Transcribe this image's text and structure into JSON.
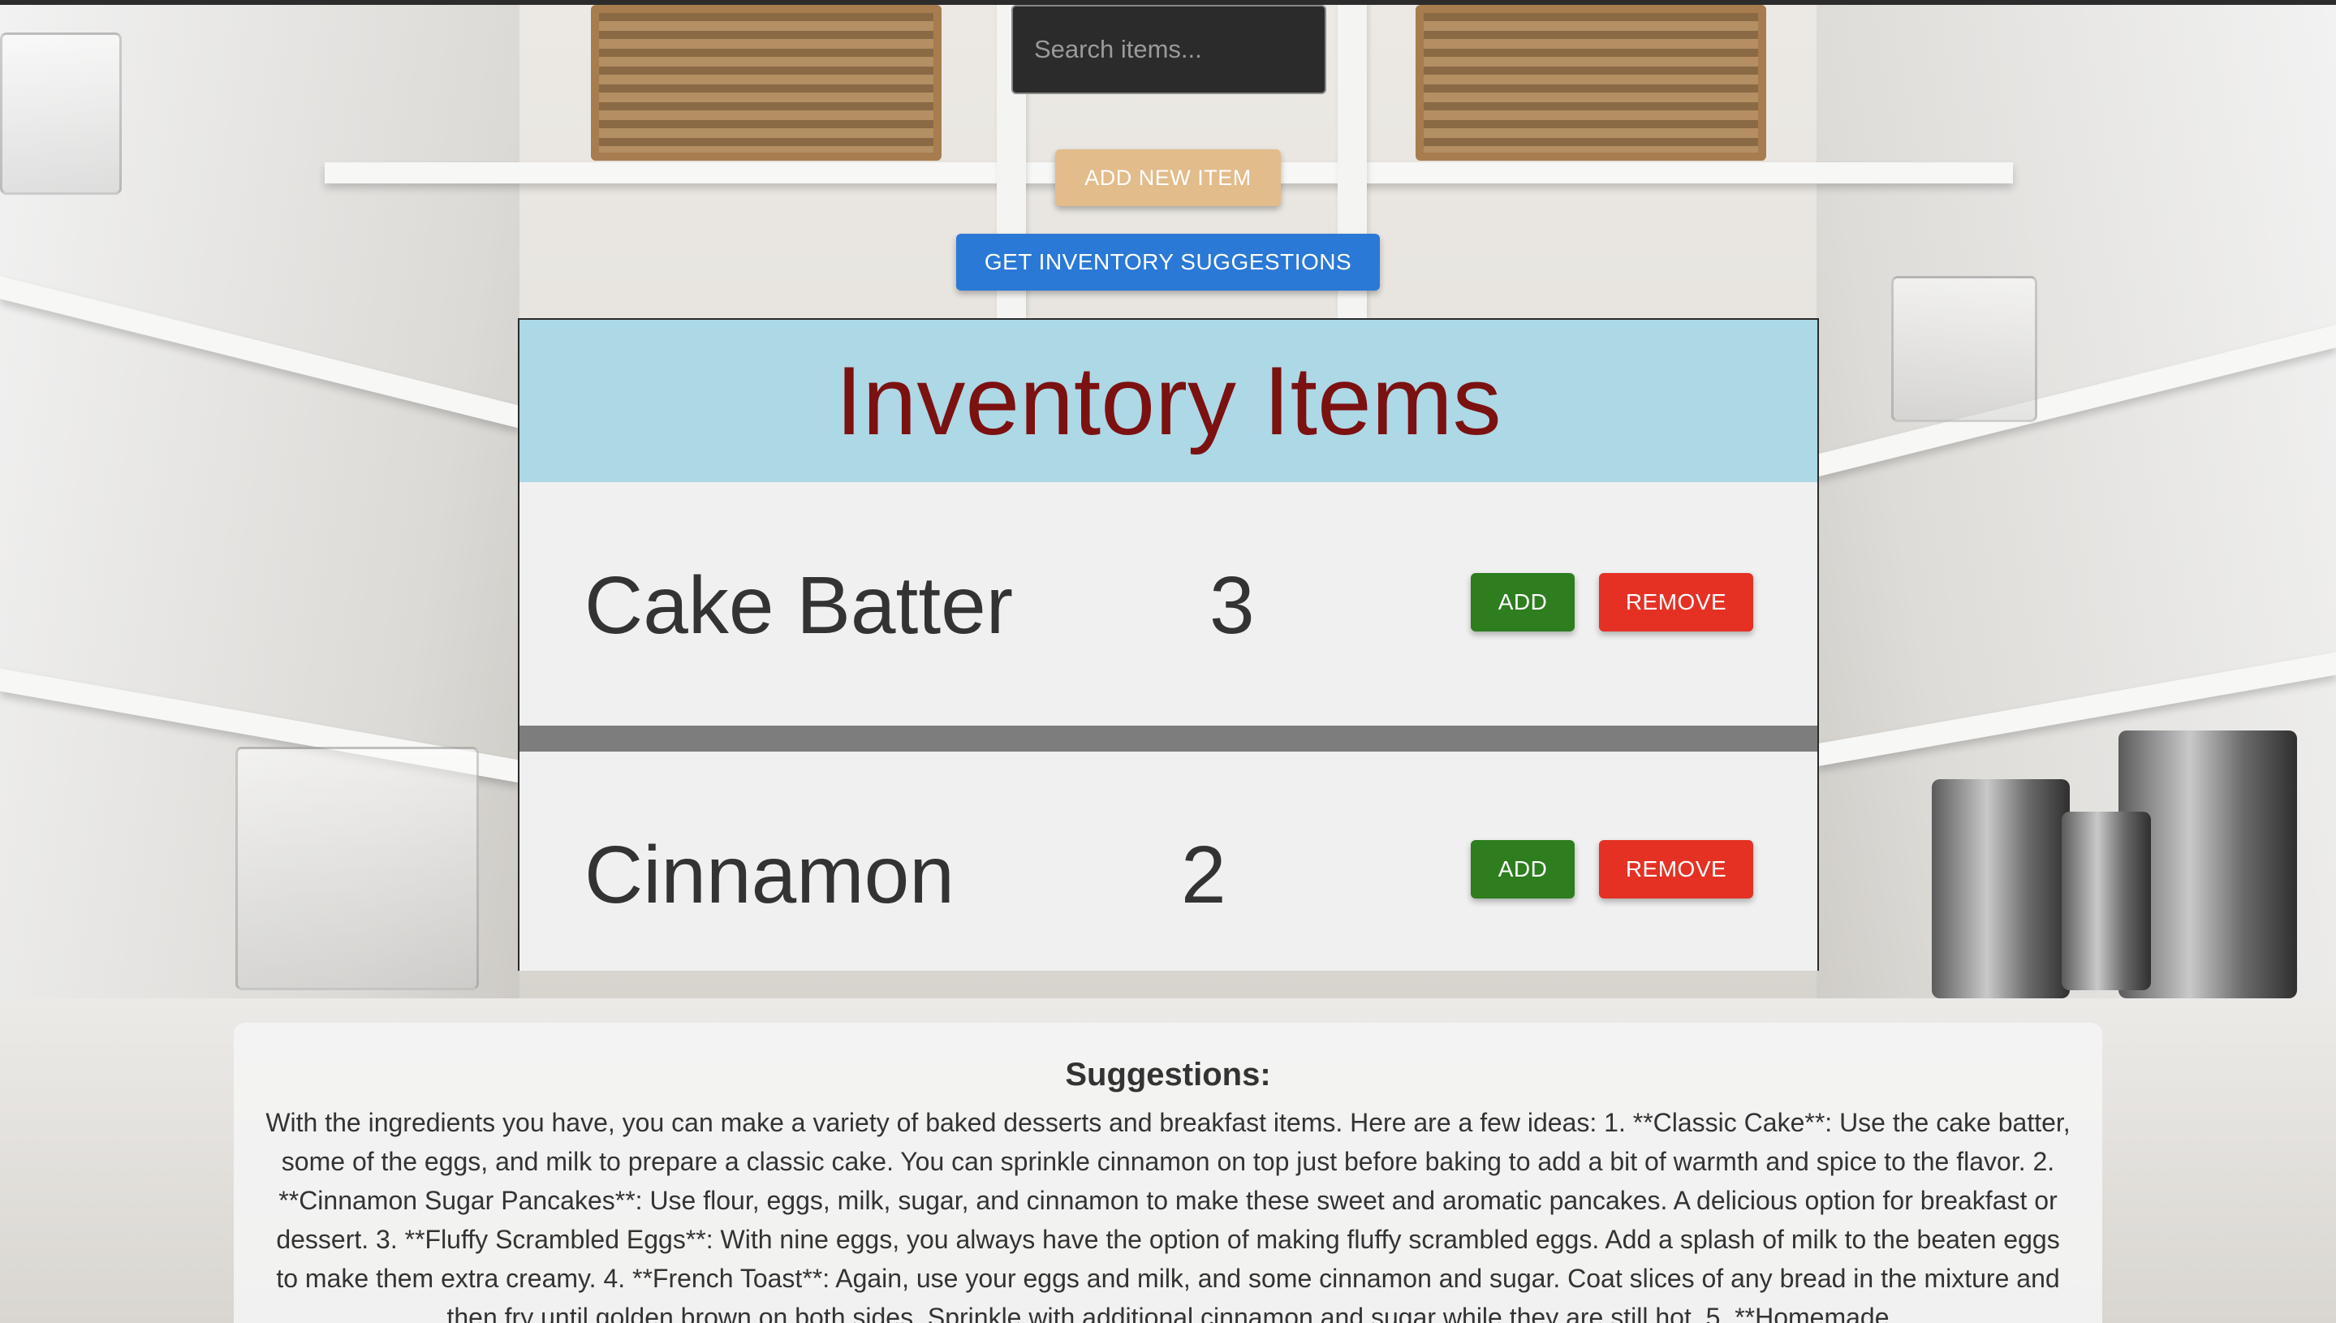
{
  "search": {
    "placeholder": "Search items..."
  },
  "actions": {
    "add_new_item": "ADD NEW ITEM",
    "get_suggestions": "GET INVENTORY SUGGESTIONS"
  },
  "inventory": {
    "title": "Inventory Items",
    "items": [
      {
        "name": "Cake Batter",
        "quantity": "3",
        "add_label": "ADD",
        "remove_label": "REMOVE"
      },
      {
        "name": "Cinnamon",
        "quantity": "2",
        "add_label": "ADD",
        "remove_label": "REMOVE"
      }
    ]
  },
  "suggestions": {
    "heading": "Suggestions:",
    "text": "With the ingredients you have, you can make a variety of baked desserts and breakfast items. Here are a few ideas: 1. **Classic Cake**: Use the cake batter, some of the eggs, and milk to prepare a classic cake. You can sprinkle cinnamon on top just before baking to add a bit of warmth and spice to the flavor. 2. **Cinnamon Sugar Pancakes**: Use flour, eggs, milk, sugar, and cinnamon to make these sweet and aromatic pancakes. A delicious option for breakfast or dessert. 3. **Fluffy Scrambled Eggs**: With nine eggs, you always have the option of making fluffy scrambled eggs. Add a splash of milk to the beaten eggs to make them extra creamy. 4. **French Toast**: Again, use your eggs and milk, and some cinnamon and sugar. Coat slices of any bread in the mixture and then fry until golden brown on both sides. Sprinkle with additional cinnamon and sugar while they are still hot. 5. **Homemade"
  },
  "colors": {
    "header_bg": "#add8e6",
    "title_color": "#7b1111",
    "add_button": "#2e7d1f",
    "remove_button": "#e53124",
    "suggest_button": "#2a79d6",
    "add_new_button": "#e2bc8b"
  }
}
